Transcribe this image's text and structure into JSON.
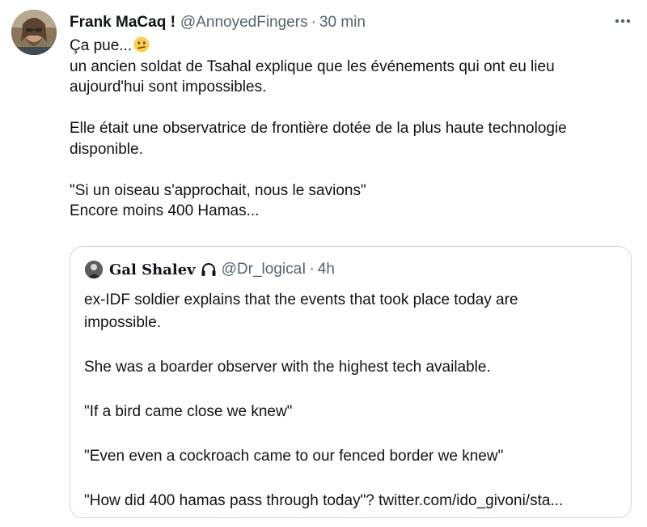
{
  "author": {
    "display_name": "Frank MaCaq !",
    "handle": "@AnnoyedFingers",
    "separator": "·",
    "time": "30 min",
    "avatar_icon": "bearded-man-avatar"
  },
  "more_icon": "more-horizontal-icon",
  "tweet": {
    "line1": "Ça pue...",
    "emoji": "confused-face-emoji",
    "line2": "un ancien soldat de Tsahal explique que les événements qui ont eu lieu",
    "line3": "aujourd'hui sont impossibles.",
    "line4": "Elle était une observatrice de frontière dotée de la plus haute technologie",
    "line5": "disponible.",
    "line6": "\"Si un oiseau s'approchait, nous le savions\"",
    "line7": "Encore moins 400 Hamas..."
  },
  "quote": {
    "display_name": "Gal Shalev",
    "badge_icon": "headphones-icon",
    "handle": "@Dr_logicaI",
    "separator": "·",
    "time": "4h",
    "line1": "ex-IDF soldier explains that the events that took place today are",
    "line2": "impossible.",
    "line3": "She was a boarder observer with the highest tech available.",
    "line4": "\"If a bird came close we knew\"",
    "line5": "\"Even even a cockroach came to our fenced border we knew\"",
    "line6": "\"How did 400 hamas pass through today\"? twitter.com/ido_givoni/sta..."
  },
  "colors": {
    "text": "#0f1419",
    "secondary": "#536471",
    "border": "#cfd9de"
  }
}
